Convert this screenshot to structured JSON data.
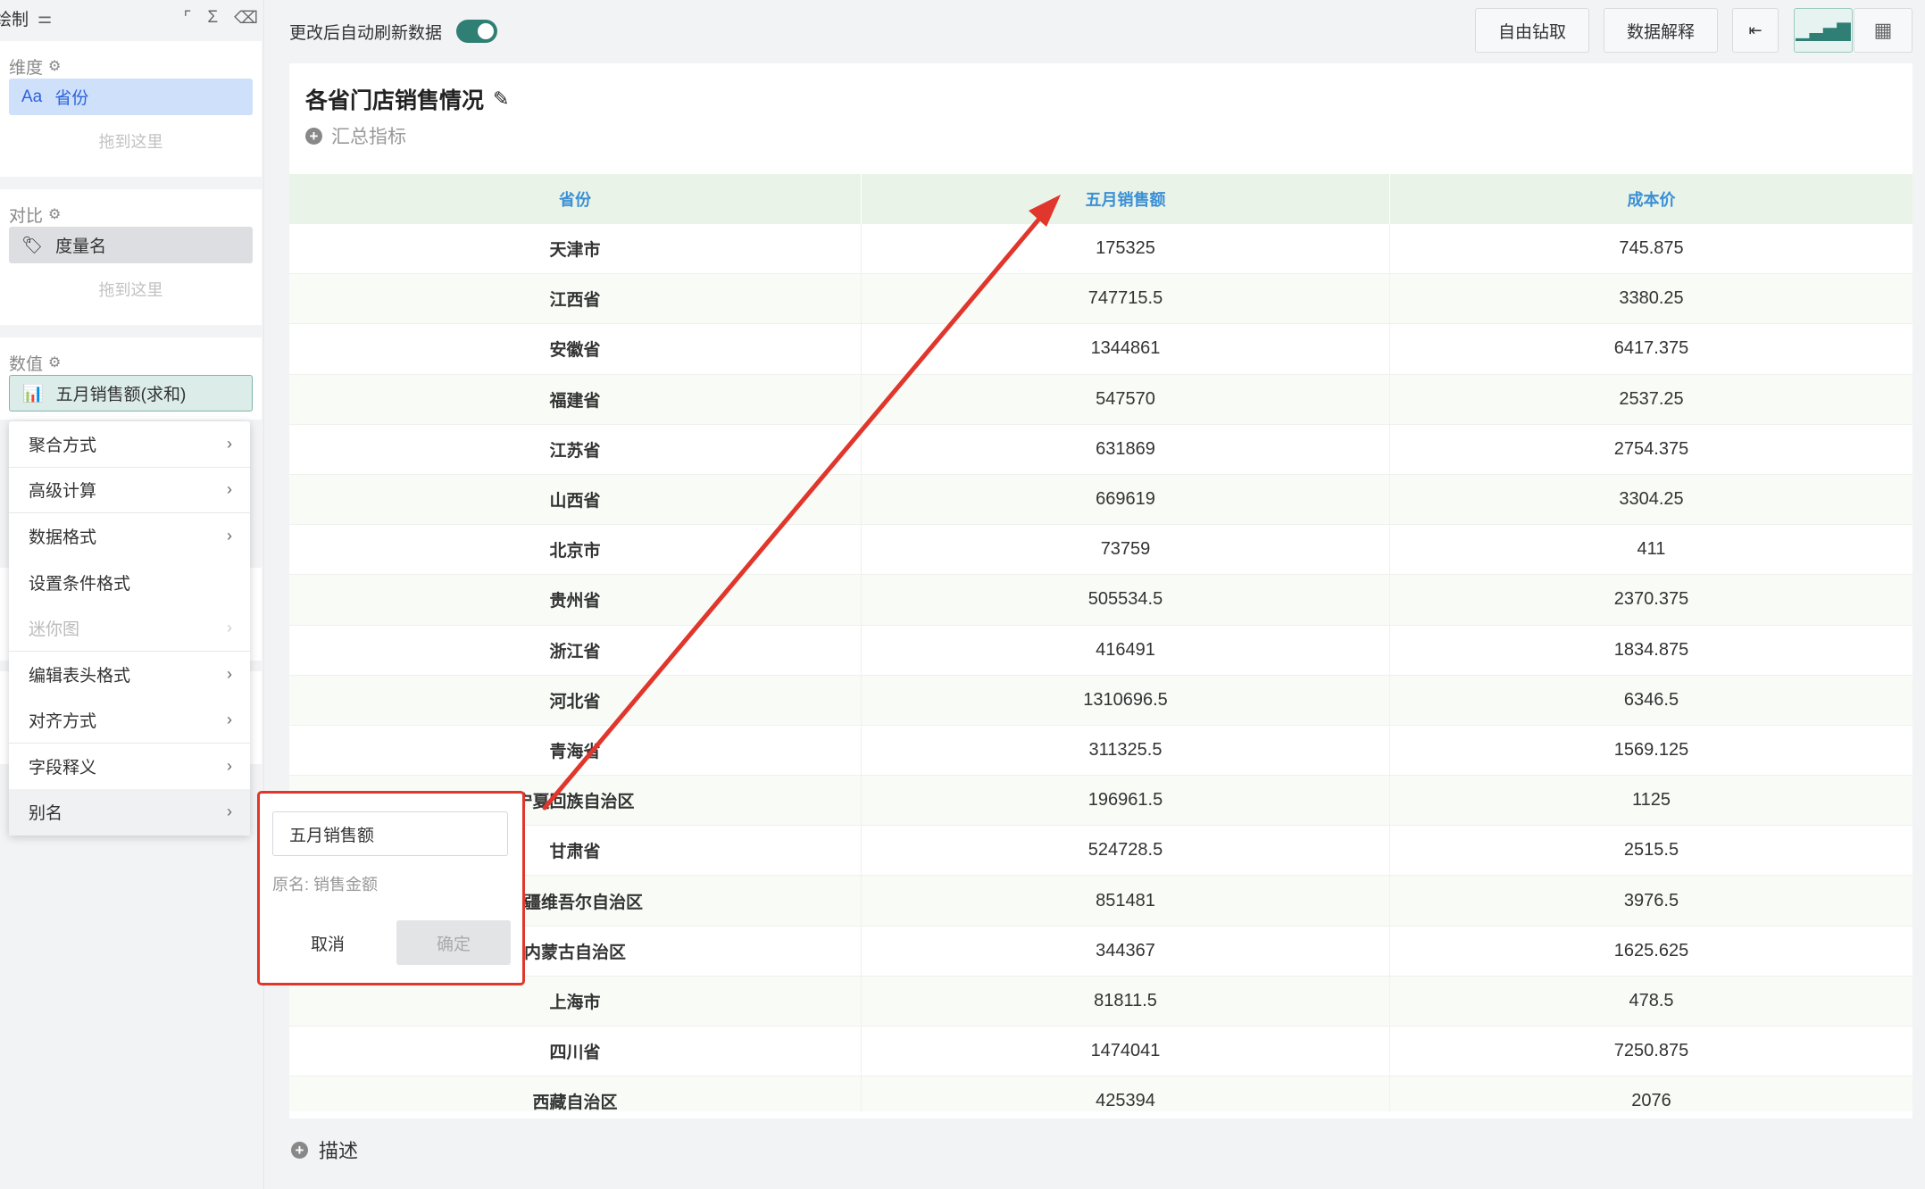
{
  "sidebar": {
    "title": "绘制",
    "dimension": {
      "title": "维度",
      "field": "省份",
      "field_icon": "Aa",
      "drop_hint": "拖到这里"
    },
    "compare": {
      "title": "对比",
      "field": "度量名",
      "drop_hint": "拖到这里"
    },
    "values": {
      "title": "数值",
      "field": "五月销售额(求和)"
    },
    "context_menu": [
      {
        "label": "聚合方式",
        "disabled": false
      },
      {
        "label": "高级计算",
        "disabled": false
      },
      {
        "label": "数据格式",
        "disabled": false
      },
      {
        "label": "设置条件格式",
        "disabled": false
      },
      {
        "label": "迷你图",
        "disabled": true
      },
      {
        "label": "编辑表头格式",
        "disabled": false
      },
      {
        "label": "对齐方式",
        "disabled": false
      },
      {
        "label": "字段释义",
        "disabled": false
      },
      {
        "label": "别名",
        "disabled": false
      }
    ]
  },
  "topbar": {
    "auto_refresh_label": "更改后自动刷新数据",
    "auto_refresh_on": true,
    "drill_button": "自由钻取",
    "explain_button": "数据解释"
  },
  "card": {
    "title": "各省门店销售情况",
    "summary_label": "汇总指标",
    "description_label": "描述"
  },
  "table": {
    "headers": [
      "省份",
      "五月销售额",
      "成本价"
    ],
    "rows": [
      [
        "天津市",
        "175325",
        "745.875"
      ],
      [
        "江西省",
        "747715.5",
        "3380.25"
      ],
      [
        "安徽省",
        "1344861",
        "6417.375"
      ],
      [
        "福建省",
        "547570",
        "2537.25"
      ],
      [
        "江苏省",
        "631869",
        "2754.375"
      ],
      [
        "山西省",
        "669619",
        "3304.25"
      ],
      [
        "北京市",
        "73759",
        "411"
      ],
      [
        "贵州省",
        "505534.5",
        "2370.375"
      ],
      [
        "浙江省",
        "416491",
        "1834.875"
      ],
      [
        "河北省",
        "1310696.5",
        "6346.5"
      ],
      [
        "青海省",
        "311325.5",
        "1569.125"
      ],
      [
        "宁夏回族自治区",
        "196961.5",
        "1125"
      ],
      [
        "甘肃省",
        "524728.5",
        "2515.5"
      ],
      [
        "新疆维吾尔自治区",
        "851481",
        "3976.5"
      ],
      [
        "内蒙古自治区",
        "344367",
        "1625.625"
      ],
      [
        "上海市",
        "81811.5",
        "478.5"
      ],
      [
        "四川省",
        "1474041",
        "7250.875"
      ],
      [
        "西藏自治区",
        "425394",
        "2076"
      ]
    ]
  },
  "alias_popup": {
    "value": "五月销售额",
    "original_name": "原名: 销售金额",
    "cancel": "取消",
    "confirm": "确定"
  },
  "colors": {
    "accent": "#2f7f74",
    "header_text": "#3b8fd5",
    "highlight": "#e0362c"
  }
}
